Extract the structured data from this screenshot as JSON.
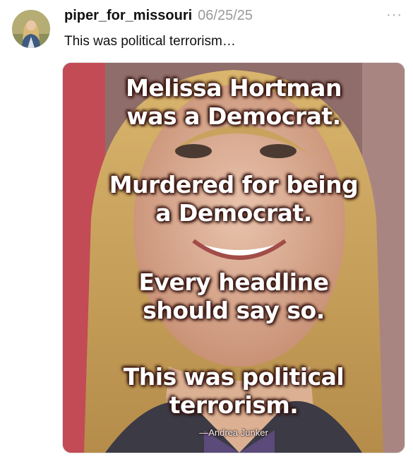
{
  "post": {
    "username": "piper_for_missouri",
    "date": "06/25/25",
    "caption": "This was political terrorism…",
    "more_label": "···"
  },
  "meme": {
    "paragraphs": [
      [
        "Melissa Hortman",
        "was a Democrat."
      ],
      [
        "Murdered for being",
        "a Democrat."
      ],
      [
        "Every headline",
        "should say so."
      ],
      [
        "This was political",
        "terrorism."
      ]
    ],
    "attribution": "—Andrea Junker"
  },
  "colors": {
    "username": "#111111",
    "date": "#9a9a9a",
    "text_outline": "#3a1410"
  },
  "icons": {
    "more": "more-horizontal-icon"
  }
}
